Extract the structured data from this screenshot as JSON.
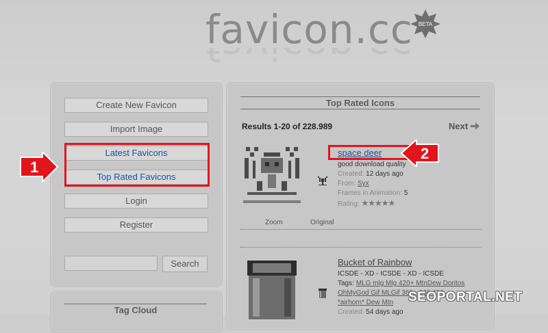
{
  "logo": {
    "text": "favicon.cc",
    "badge": "BETA"
  },
  "sidebar": {
    "items": [
      {
        "label": "Create New Favicon"
      },
      {
        "label": "Import Image"
      },
      {
        "label": "Latest Favicons"
      },
      {
        "label": "Top Rated Favicons"
      },
      {
        "label": "Login"
      },
      {
        "label": "Register"
      }
    ],
    "search_button": "Search",
    "tag_cloud_title": "Tag Cloud"
  },
  "main": {
    "section_title": "Top Rated Icons",
    "results": "Results 1-20 of 228.989",
    "next": "Next",
    "icons": [
      {
        "title": "space deer",
        "description": "good download quality",
        "created_label": "Created:",
        "created_value": "12 days ago",
        "from_label": "From:",
        "from_value": "Syx",
        "frames_label": "Frames in Animation:",
        "frames_value": "5",
        "rating_label": "Rating:",
        "zoom_label": "Zoom",
        "original_label": "Original"
      },
      {
        "title": "Bucket of Rainbow",
        "description": "ICSDE - XD - ICSDE - XD - ICSDE",
        "tags_label": "Tags:",
        "tags_line1": "MLG mlg Mlg 420+ MtnDew Doritos",
        "tags_line2": "OhMyGod Gif MLGif 360+ 360 420",
        "tags_line3": "*airhorn* Dew Mtn",
        "created_label": "Created:",
        "created_value": "54 days ago"
      }
    ]
  },
  "callouts": {
    "one": "1",
    "two": "2"
  },
  "watermark": "SEOPORTAL.NET",
  "colors": {
    "highlight": "#e3141c",
    "link_blue": "#1b51a7"
  }
}
